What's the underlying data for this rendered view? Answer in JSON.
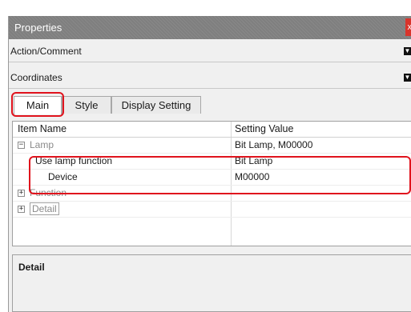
{
  "window": {
    "title": "Properties",
    "close_label": "x"
  },
  "sections": [
    {
      "label": "Action/Comment",
      "icon": "dropdown-icon"
    },
    {
      "label": "Coordinates",
      "icon": "dropdown-icon"
    }
  ],
  "tabs": [
    {
      "label": "Main",
      "active": true
    },
    {
      "label": "Style",
      "active": false
    },
    {
      "label": "Display Setting",
      "active": false
    }
  ],
  "grid": {
    "headers": [
      "Item Name",
      "Setting Value"
    ],
    "rows": [
      {
        "name": "Lamp",
        "value": "Bit Lamp, M00000",
        "expander": "⊟",
        "style": "gray"
      },
      {
        "name": "Use lamp function",
        "value": "Bit Lamp",
        "expander": "",
        "style": "normal"
      },
      {
        "name": "Device",
        "value": "M00000",
        "expander": "",
        "style": "normal"
      },
      {
        "name": "Function",
        "value": "",
        "expander": "⊞",
        "style": "gray"
      },
      {
        "name": "Detail",
        "value": "",
        "expander": "⊞",
        "style": "boxed"
      }
    ]
  },
  "detail_pane": {
    "label": "Detail"
  },
  "colors": {
    "highlight": "#e0131d",
    "titlebar": "#7f7f7f",
    "close": "#d9342b"
  }
}
